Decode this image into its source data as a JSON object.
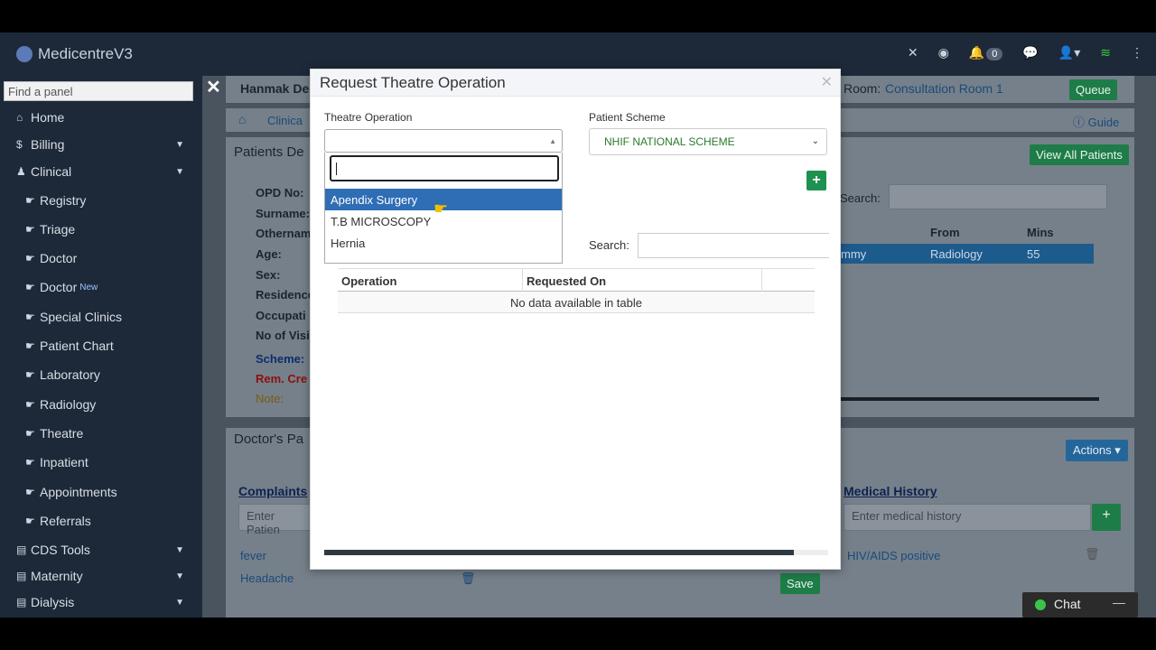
{
  "app": {
    "title": "MedicentreV3"
  },
  "topnav": {
    "notification_count": "0"
  },
  "sidebar": {
    "search_placeholder": "Find a panel",
    "items": [
      {
        "label": "Home",
        "icon": "home-icon"
      },
      {
        "label": "Billing",
        "icon": "dollar-icon"
      },
      {
        "label": "Clinical",
        "icon": "user-md-icon"
      },
      {
        "label": "Registry",
        "icon": "hand-point-icon"
      },
      {
        "label": "Triage",
        "icon": "hand-point-icon"
      },
      {
        "label": "Doctor",
        "icon": "hand-point-icon"
      },
      {
        "label": "Doctor",
        "icon": "hand-point-icon",
        "badge": "New"
      },
      {
        "label": "Special Clinics",
        "icon": "hand-point-icon"
      },
      {
        "label": "Patient Chart",
        "icon": "hand-point-icon"
      },
      {
        "label": "Laboratory",
        "icon": "hand-point-icon"
      },
      {
        "label": "Radiology",
        "icon": "hand-point-icon"
      },
      {
        "label": "Theatre",
        "icon": "hand-point-icon"
      },
      {
        "label": "Inpatient",
        "icon": "hand-point-icon"
      },
      {
        "label": "Appointments",
        "icon": "hand-point-icon"
      },
      {
        "label": "Referrals",
        "icon": "hand-point-icon"
      },
      {
        "label": "CDS Tools",
        "icon": "book-icon"
      },
      {
        "label": "Maternity",
        "icon": "book-icon"
      },
      {
        "label": "Dialysis",
        "icon": "book-icon"
      }
    ]
  },
  "background": {
    "hospital_name": "Hanmak De",
    "breadcrumb_clinical": "Clinica",
    "room_label": "Room:",
    "room_value": "Consultation Room 1",
    "queue_button": "Queue",
    "guide_link": "Guide",
    "patients_details_title": "Patients De",
    "view_all_patients": "View All Patients",
    "search_label": "Search:",
    "patient_fields": [
      "OPD No:",
      "Surname:",
      "Othernam",
      "Age:",
      "Sex:",
      "Residence",
      "Occupati",
      "No of Visi"
    ],
    "scheme_label": "Scheme:",
    "rem_label": "Rem. Cre",
    "note_label": "Note:",
    "queue_table": {
      "headers": [
        "From",
        "Mins"
      ],
      "row": {
        "name": "mmy",
        "from": "Radiology",
        "mins": "55"
      }
    },
    "doctors_pad_title": "Doctor's Pa",
    "actions_button": "Actions",
    "complaints_title": "Complaints",
    "complaints_placeholder": "Enter Patien",
    "complaints": [
      "fever",
      "Headache"
    ],
    "medical_history_title": "Medical History",
    "medical_history_placeholder": "Enter medical history",
    "medical_history": [
      "HIV/AIDS positive"
    ],
    "save_button": "Save"
  },
  "modal": {
    "title": "Request Theatre Operation",
    "theatre_operation_label": "Theatre Operation",
    "patient_scheme_label": "Patient Scheme",
    "patient_scheme_value": "NHIF NATIONAL SCHEME",
    "dropdown_options": [
      "Apendix Surgery",
      "T.B MICROSCOPY",
      "Hernia"
    ],
    "highlighted_option": "Apendix Surgery",
    "search_label": "Search:",
    "table_headers": [
      "Operation",
      "Requested On",
      ""
    ],
    "empty_message": "No data available in table"
  },
  "chat": {
    "label": "Chat"
  }
}
